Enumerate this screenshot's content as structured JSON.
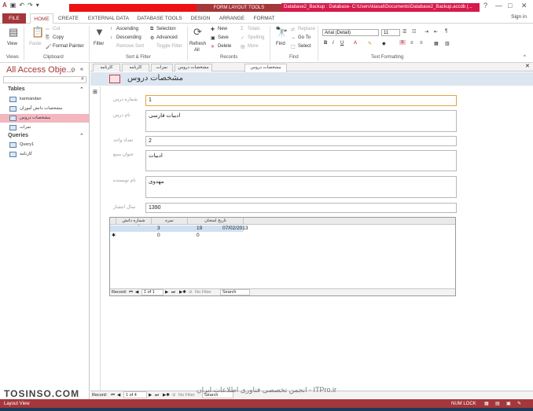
{
  "titlebar": {
    "context_tools": "FORM LAYOUT TOOLS",
    "document_title": "Database2_Backup : Database- C:\\Users\\kiasat\\Documents\\Database2_Backup.accdb (...",
    "window_controls": [
      "?",
      "—",
      "□",
      "✕"
    ]
  },
  "tabs": [
    "FILE",
    "HOME",
    "CREATE",
    "EXTERNAL DATA",
    "DATABASE TOOLS",
    "DESIGN",
    "ARRANGE",
    "FORMAT"
  ],
  "active_tab": "HOME",
  "signin": "Sign in",
  "ribbon": {
    "views": {
      "view": "View",
      "group": "Views"
    },
    "clipboard": {
      "paste": "Paste",
      "cut": "Cut",
      "copy": "Copy",
      "format_painter": "Format Painter",
      "group": "Clipboard"
    },
    "sort_filter": {
      "filter": "Filter",
      "ascending": "Ascending",
      "descending": "Descending",
      "remove_sort": "Remove Sort",
      "selection": "Selection",
      "advanced": "Advanced",
      "toggle_filter": "Toggle Filter",
      "group": "Sort & Filter"
    },
    "records": {
      "refresh": "Refresh",
      "all": "All",
      "new": "New",
      "save": "Save",
      "delete": "Delete",
      "totals": "Totals",
      "spelling": "Spelling",
      "more": "More",
      "group": "Records"
    },
    "find": {
      "find": "Find",
      "replace": "Replace",
      "goto": "Go To",
      "select": "Select",
      "group": "Find"
    },
    "text_formatting": {
      "font": "Arial (Detail)",
      "size": "11",
      "group": "Text Formatting"
    }
  },
  "nav": {
    "title": "All Access Obje...",
    "tables_label": "Tables",
    "tables": [
      "karmandan",
      "مشخصات دانش آموزان",
      "مشخصات دروس",
      "نمرات"
    ],
    "queries_label": "Queries",
    "queries": [
      "Query1",
      "کارنامه"
    ]
  },
  "doc_tabs": [
    "کارنامه",
    "کارنامه",
    "نمرات",
    "مشخصات دروس",
    "مشخصات دروس"
  ],
  "form": {
    "title": "مشخصات دروس",
    "fields": [
      {
        "label": "شماره درس",
        "value": "1"
      },
      {
        "label": "نام درس",
        "value": "ادبیات فارسی"
      },
      {
        "label": "تعداد واحد",
        "value": "2"
      },
      {
        "label": "عنوان منبع",
        "value": "ادبیات"
      },
      {
        "label": "نام نویسنده",
        "value": "مهدوی"
      },
      {
        "label": "سال انتشار",
        "value": "1390"
      }
    ]
  },
  "subform": {
    "headers": [
      "تاریخ امتحان",
      "نمره",
      "شماره دانش آموزی"
    ],
    "rows": [
      {
        "date": "07/02/2013",
        "score": "19",
        "student": "3"
      },
      {
        "date": "",
        "score": "0",
        "student": "0"
      }
    ],
    "nav": {
      "record_label": "Record:",
      "position": "1 of 1",
      "no_filter": "No Filter",
      "search": "Search"
    }
  },
  "main_nav": {
    "record_label": "Record:",
    "position": "1 of 4",
    "no_filter": "No Filter",
    "search": "Search"
  },
  "status": {
    "left": "Layout View",
    "numlock": "NUM LOCK"
  },
  "watermarks": {
    "left": "TOSINSO.COM",
    "right": "انجمن تخصصی فناوری اطلاعات ایران - ITPro.ir"
  }
}
